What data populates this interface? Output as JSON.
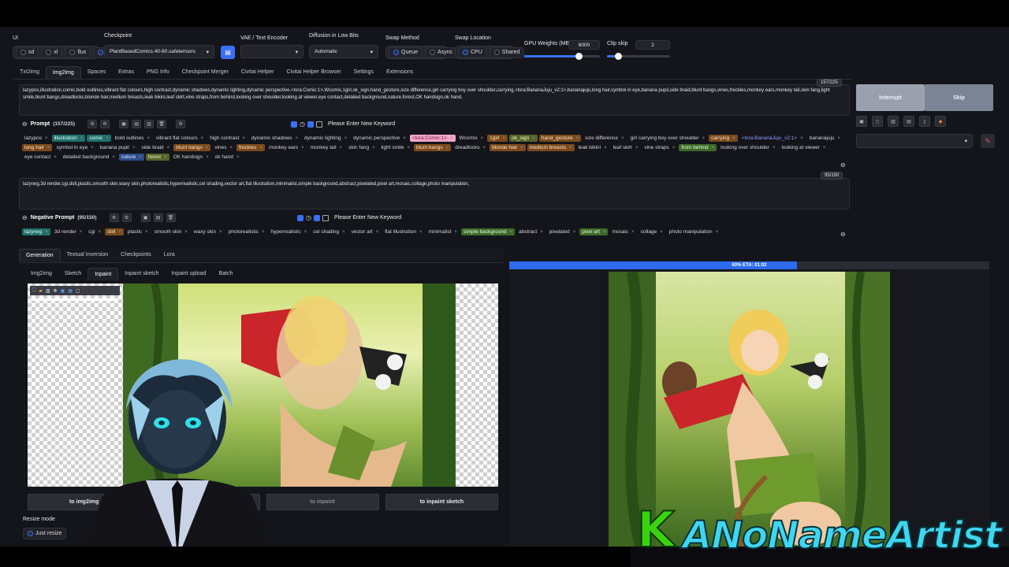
{
  "top": {
    "ui_label": "UI",
    "ui_options": [
      "sd",
      "xl",
      "flux",
      "all"
    ],
    "ui_selected": "all",
    "checkpoint_label": "Checkpoint",
    "checkpoint_value": "PlantBasedComics.40-60.safetensors",
    "vae_label": "VAE / Text Encoder",
    "vae_value": "",
    "diffusion_label": "Diffusion in Low Bits",
    "diffusion_value": "Automatic",
    "swap_method_label": "Swap Method",
    "swap_method_options": [
      "Queue",
      "Async"
    ],
    "swap_location_label": "Swap Location",
    "swap_location_options": [
      "CPU",
      "Shared"
    ],
    "gpu_weights_label": "GPU Weights (MB)",
    "gpu_weights_value": "6000",
    "gpu_weights_fraction": 0.72,
    "clip_skip_label": "Clip skip",
    "clip_skip_value": "2",
    "clip_skip_fraction": 0.18
  },
  "main_tabs": [
    "Txt2img",
    "Img2img",
    "Spaces",
    "Extras",
    "PNG Info",
    "Checkpoint Merger",
    "Civitai Helper",
    "Civitai Helper Browser",
    "Settings",
    "Extensions"
  ],
  "main_tab_active": "Img2img",
  "prompt": {
    "counter": "157/225",
    "text": "lazypos,illustration,comic,bold outlines,vibrant flat colours,high contrast,dynamic shadows,dynamic lighting,dynamic perspective,<lora:Comic:1>,Wcomix,1girl,ok_sign,hand_gesture,size difference,girl carrying boy over shoulder,carrying,<lora:BananaJuju_v2:1>,bananajuju,long hair,symbol in eye,banana pupil,side braid,blunt bangs,vines,freckles,monkey ears,monkey tail,skin fang,light smile,blunt bangs,dreadlocks,blonde hair,medium breasts,leak bikini,leaf skirt,vine straps,from behind,looking over shoulder,looking at viewer,eye contact,detailed background,nature,forest,OK handsign,ok hand,",
    "label": "Prompt",
    "label_count": "(157/225)",
    "keyword_placeholder": "Please Enter New Keyword",
    "tags": [
      {
        "t": "lazypos",
        "c": ""
      },
      {
        "t": "illustration",
        "c": "c-teal"
      },
      {
        "t": "comic",
        "c": "c-teal"
      },
      {
        "t": "bold outlines",
        "c": ""
      },
      {
        "t": "vibrant flat colours",
        "c": ""
      },
      {
        "t": "high contrast",
        "c": ""
      },
      {
        "t": "dynamic shadows",
        "c": ""
      },
      {
        "t": "dynamic lighting",
        "c": ""
      },
      {
        "t": "dynamic perspective",
        "c": ""
      },
      {
        "t": "<lora:Comic:1>",
        "c": "c-pink"
      },
      {
        "t": "Wcomix",
        "c": ""
      },
      {
        "t": "1girl",
        "c": "c-orange"
      },
      {
        "t": "ok_sign",
        "c": "c-olive"
      },
      {
        "t": "hand_gesture",
        "c": "c-orange"
      },
      {
        "t": "size difference",
        "c": ""
      },
      {
        "t": "girl carrying boy over shoulder",
        "c": ""
      },
      {
        "t": "carrying",
        "c": "c-orange"
      },
      {
        "t": "<lora:BananaJuju_v2:1>",
        "c": "c-lora"
      },
      {
        "t": "bananajuju",
        "c": ""
      },
      {
        "t": "long hair",
        "c": "c-orange"
      },
      {
        "t": "symbol in eye",
        "c": ""
      },
      {
        "t": "banana pupil",
        "c": ""
      },
      {
        "t": "side braid",
        "c": ""
      },
      {
        "t": "blunt bangs",
        "c": "c-orange"
      },
      {
        "t": "vines",
        "c": ""
      },
      {
        "t": "freckles",
        "c": "c-orange"
      },
      {
        "t": "monkey ears",
        "c": ""
      },
      {
        "t": "monkey tail",
        "c": ""
      },
      {
        "t": "skin fang",
        "c": ""
      },
      {
        "t": "light smile",
        "c": ""
      },
      {
        "t": "blunt bangs",
        "c": "c-orange"
      },
      {
        "t": "dreadlocks",
        "c": ""
      },
      {
        "t": "blonde hair",
        "c": "c-orange"
      },
      {
        "t": "medium breasts",
        "c": "c-orange"
      },
      {
        "t": "leak bikini",
        "c": ""
      },
      {
        "t": "leaf skirt",
        "c": ""
      },
      {
        "t": "vine straps",
        "c": ""
      },
      {
        "t": "from behind",
        "c": "c-green"
      },
      {
        "t": "looking over shoulder",
        "c": ""
      },
      {
        "t": "looking at viewer",
        "c": ""
      },
      {
        "t": "eye contact",
        "c": ""
      },
      {
        "t": "detailed background",
        "c": ""
      },
      {
        "t": "nature",
        "c": "c-blue"
      },
      {
        "t": "forest",
        "c": "c-olive"
      },
      {
        "t": "OK handsign",
        "c": ""
      },
      {
        "t": "ok hand",
        "c": ""
      }
    ]
  },
  "negative": {
    "counter": "95/150",
    "text": "lazyneg,3d render,cgi,doll,plastic,smooth skin,waxy skin,photorealistic,hyperrealistic,cel shading,vector art,flat illustration,minimalist,simple background,abstract,pixelated,pixel art,mosaic,collage,photo manipulation,",
    "label": "Negative Prompt",
    "label_count": "(95/150)",
    "keyword_placeholder": "Please Enter New Keyword",
    "tags": [
      {
        "t": "lazyneg",
        "c": "c-teal"
      },
      {
        "t": "3d render",
        "c": ""
      },
      {
        "t": "cgi",
        "c": ""
      },
      {
        "t": "doll",
        "c": "c-orange"
      },
      {
        "t": "plastic",
        "c": ""
      },
      {
        "t": "smooth skin",
        "c": ""
      },
      {
        "t": "waxy skin",
        "c": ""
      },
      {
        "t": "photorealistic",
        "c": ""
      },
      {
        "t": "hyperrealistic",
        "c": ""
      },
      {
        "t": "cel shading",
        "c": ""
      },
      {
        "t": "vector art",
        "c": ""
      },
      {
        "t": "flat illustration",
        "c": ""
      },
      {
        "t": "minimalist",
        "c": ""
      },
      {
        "t": "simple background",
        "c": "c-green"
      },
      {
        "t": "abstract",
        "c": ""
      },
      {
        "t": "pixelated",
        "c": ""
      },
      {
        "t": "pixel art",
        "c": "c-green"
      },
      {
        "t": "mosaic",
        "c": ""
      },
      {
        "t": "collage",
        "c": ""
      },
      {
        "t": "photo manipulation",
        "c": ""
      }
    ]
  },
  "right_panel": {
    "interrupt": "Interrupt",
    "skip": "Skip"
  },
  "gen_tabs": [
    "Generation",
    "Textual Inversion",
    "Checkpoints",
    "Lora"
  ],
  "gen_tab_active": "Generation",
  "sub_tabs": [
    "Img2img",
    "Sketch",
    "Inpaint",
    "Inpaint sketch",
    "Inpaint upload",
    "Batch"
  ],
  "sub_tab_active": "Inpaint",
  "send_buttons": [
    "to img2img",
    "",
    "to inpaint",
    "to inpaint sketch"
  ],
  "resize_mode_label": "Resize mode",
  "resize_option": "Just resize",
  "progress": {
    "text": "60% ETA: 01:02",
    "fraction": 0.6
  },
  "watermark": {
    "letter": "K",
    "name": "ANoNameArtist"
  },
  "colors": {
    "accent": "#3a6ff7",
    "progress": "#2d6cf0",
    "watermark_green": "#39d40f"
  }
}
